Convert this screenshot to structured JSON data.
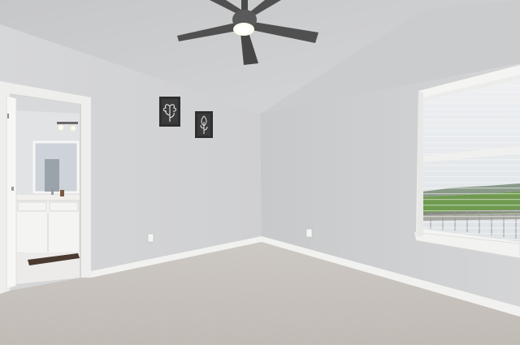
{
  "scene": {
    "subject": "empty-bedroom-interior",
    "objects": [
      "ceiling-fan",
      "wall-art-left",
      "wall-art-right",
      "ensuite-bathroom-doorway",
      "window-with-blinds",
      "carpet-floor",
      "baseboards",
      "electrical-outlets"
    ]
  },
  "colors": {
    "ceiling": "#cfd0d2",
    "left_wall": "#d3d4d6",
    "right_wall": "#cdcecf",
    "carpet": "#c9c4bf",
    "trim": "#f3f3f1",
    "frame": "#3a3a3a",
    "window_sky": "#e4e7ea",
    "grass": "#6f9a4f"
  }
}
